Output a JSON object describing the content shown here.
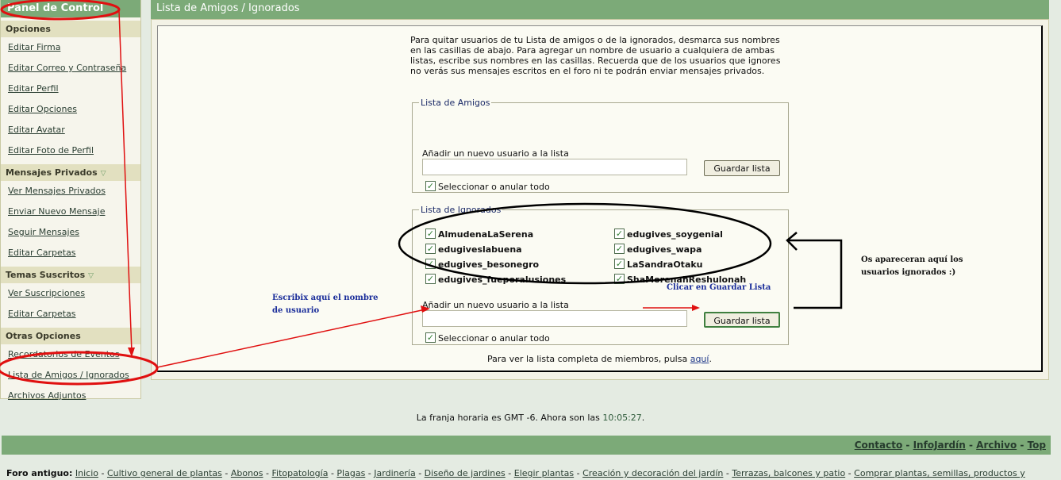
{
  "sidebar": {
    "title": "Panel de Control",
    "sections": [
      {
        "heading": "Opciones",
        "items": [
          "Editar Firma",
          "Editar Correo y Contraseña",
          "Editar Perfil",
          "Editar Opciones",
          "Editar Avatar",
          "Editar Foto de Perfil"
        ]
      },
      {
        "heading": "Mensajes Privados",
        "items": [
          "Ver Mensajes Privados",
          "Enviar Nuevo Mensaje",
          "Seguir Mensajes",
          "Editar Carpetas"
        ]
      },
      {
        "heading": "Temas Suscritos",
        "items": [
          "Ver Suscripciones",
          "Editar Carpetas"
        ]
      },
      {
        "heading": "Otras Opciones",
        "items": [
          "Recordatorios de Eventos",
          "Lista de Amigos / Ignorados",
          "Archivos Adjuntos"
        ]
      }
    ]
  },
  "main": {
    "title": "Lista de Amigos / Ignorados",
    "intro": "Para quitar usuarios de tu Lista de amigos o de la ignorados, desmarca sus nombres en las casillas de abajo. Para agregar un nombre de usuario a cualquiera de ambas listas, escribe sus nombres en las casillas. Recuerda que de los usuarios que ignores no verás sus mensajes escritos en el foro ni te podrán enviar mensajes privados.",
    "friends": {
      "legend": "Lista de Amigos",
      "add_label": "Añadir un nuevo usuario a la lista",
      "add_value": "",
      "save_label": "Guardar lista",
      "select_all": "Seleccionar o anular todo"
    },
    "ignored": {
      "legend": "Lista de Ignorados",
      "users_left": [
        "AlmudenaLaSerena",
        "edugiveslabuena",
        "edugives_besonegro",
        "edugives_fueporalusiones"
      ],
      "users_right": [
        "edugives_soygenial",
        "edugives_wapa",
        "LaSandraOtaku",
        "ShaMorenahReshulonah"
      ],
      "add_label": "Añadir un nuevo usuario a la lista",
      "add_value": "",
      "save_label": "Guardar lista",
      "select_all": "Seleccionar o anular todo"
    },
    "members_note": "Para ver la lista completa de miembros, pulsa",
    "members_link": "aquí",
    "members_end": "."
  },
  "annotations": {
    "write_name": "Escribix aquí el nombre de usuario",
    "click_save": "Clicar en Guardar Lista",
    "appear_here": "Os apareceran aquí los usuarios ignorados :)",
    "colors": {
      "red": "#e01010",
      "blue": "#1a2d9a",
      "black": "#000000"
    }
  },
  "footer": {
    "timezone_text": "La franja horaria es GMT -6. Ahora son las",
    "clock": "10:05:27",
    "clock_end": ".",
    "links": [
      "Contacto",
      "InfoJardín",
      "Archivo",
      "Top"
    ],
    "legacy_label": "Foro antiguo:",
    "legacy_links": [
      "Inicio",
      "Cultivo general de plantas",
      "Abonos",
      "Fitopatología",
      "Plagas",
      "Jardinería",
      "Diseño de jardines",
      "Elegir plantas",
      "Creación y decoración del jardín",
      "Terrazas, balcones y patio",
      "Comprar plantas, semillas, productos y"
    ]
  },
  "colors": {
    "header_green": "#7caa78",
    "panel_bg": "#f6f5ec",
    "section_bg": "#e2e0c0",
    "page_bg": "#e4ebe2"
  }
}
